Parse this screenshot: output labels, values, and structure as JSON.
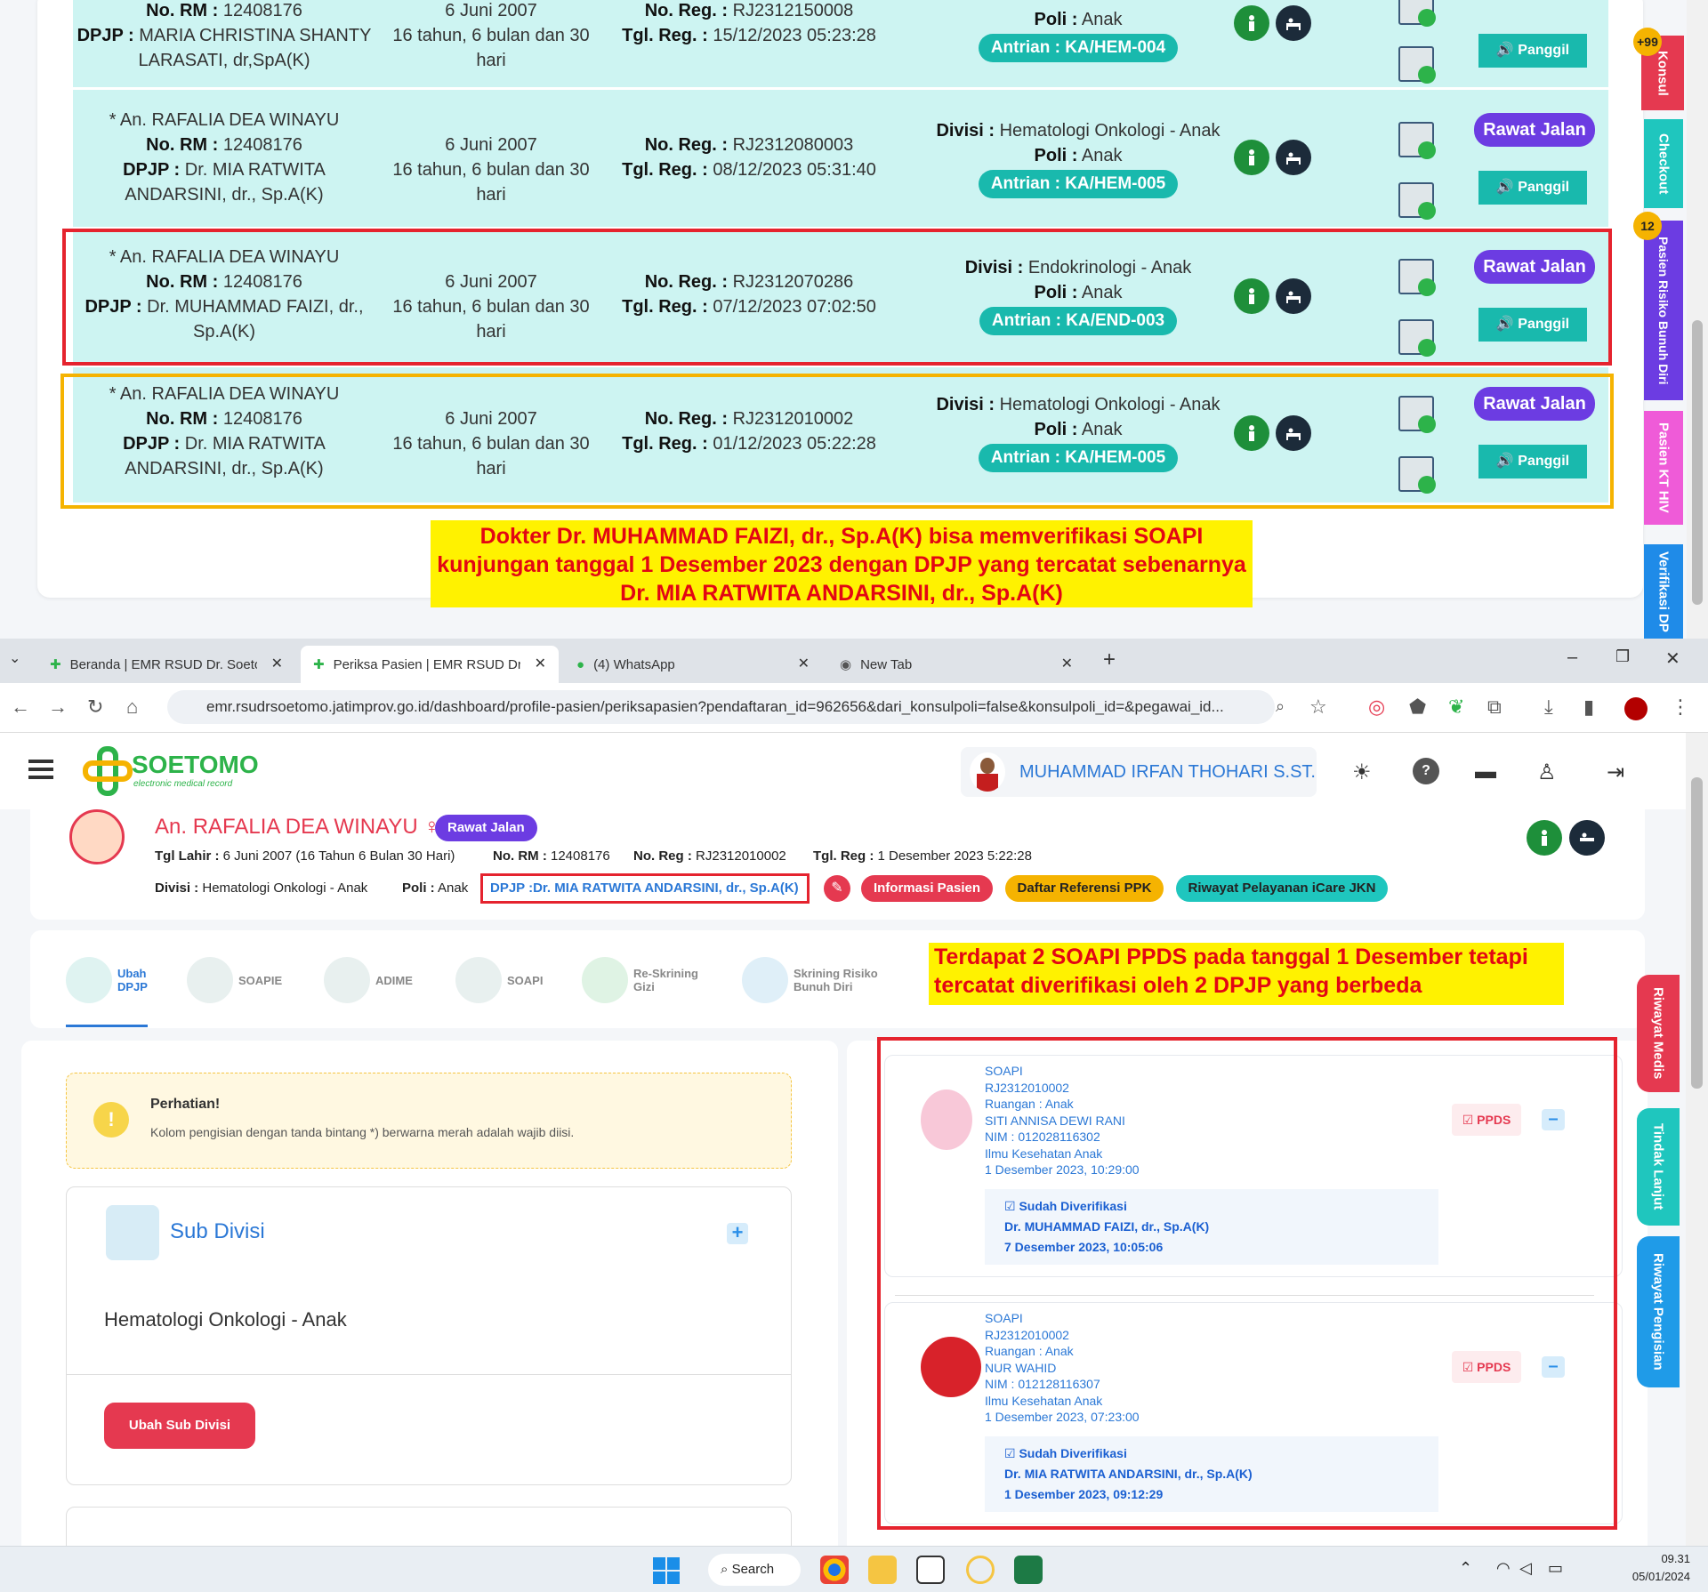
{
  "top_section": {
    "rows": [
      {
        "patient": "",
        "rm_label": "No. RM :",
        "rm": "12408176",
        "dpjp_label": "DPJP :",
        "dpjp": "MARIA CHRISTINA SHANTY LARASATI, dr,SpA(K)",
        "dob": "6 Juni 2007",
        "age": "16 tahun, 6 bulan dan 30 hari",
        "reg_label": "No. Reg. :",
        "reg": "RJ2312150008",
        "tgl_label": "Tgl. Reg. :",
        "tgl": "15/12/2023 05:23:28",
        "divisi_label": "",
        "divisi": "",
        "poli_label": "Poli :",
        "poli": "Anak",
        "antrian": "Antrian : KA/HEM-004",
        "status_btn": "",
        "call_btn": "Panggil"
      },
      {
        "patient": "* An. RAFALIA DEA WINAYU",
        "rm_label": "No. RM :",
        "rm": "12408176",
        "dpjp_label": "DPJP :",
        "dpjp": "Dr. MIA RATWITA ANDARSINI, dr., Sp.A(K)",
        "dob": "6 Juni 2007",
        "age": "16 tahun, 6 bulan dan 30 hari",
        "reg_label": "No. Reg. :",
        "reg": "RJ2312080003",
        "tgl_label": "Tgl. Reg. :",
        "tgl": "08/12/2023 05:31:40",
        "divisi_label": "Divisi :",
        "divisi": "Hematologi Onkologi - Anak",
        "poli_label": "Poli :",
        "poli": "Anak",
        "antrian": "Antrian : KA/HEM-005",
        "status_btn": "Rawat Jalan",
        "call_btn": "Panggil"
      },
      {
        "patient": "* An. RAFALIA DEA WINAYU",
        "rm_label": "No. RM :",
        "rm": "12408176",
        "dpjp_label": "DPJP :",
        "dpjp": "Dr. MUHAMMAD FAIZI, dr., Sp.A(K)",
        "dob": "6 Juni 2007",
        "age": "16 tahun, 6 bulan dan 30 hari",
        "reg_label": "No. Reg. :",
        "reg": "RJ2312070286",
        "tgl_label": "Tgl. Reg. :",
        "tgl": "07/12/2023 07:02:50",
        "divisi_label": "Divisi :",
        "divisi": "Endokrinologi - Anak",
        "poli_label": "Poli :",
        "poli": "Anak",
        "antrian": "Antrian : KA/END-003",
        "status_btn": "Rawat Jalan",
        "call_btn": "Panggil"
      },
      {
        "patient": "* An. RAFALIA DEA WINAYU",
        "rm_label": "No. RM :",
        "rm": "12408176",
        "dpjp_label": "DPJP :",
        "dpjp": "Dr. MIA RATWITA ANDARSINI, dr., Sp.A(K)",
        "dob": "6 Juni 2007",
        "age": "16 tahun, 6 bulan dan 30 hari",
        "reg_label": "No. Reg. :",
        "reg": "RJ2312010002",
        "tgl_label": "Tgl. Reg. :",
        "tgl": "01/12/2023 05:22:28",
        "divisi_label": "Divisi :",
        "divisi": "Hematologi Onkologi - Anak",
        "poli_label": "Poli :",
        "poli": "Anak",
        "antrian": "Antrian : KA/HEM-005",
        "status_btn": "Rawat Jalan",
        "call_btn": "Panggil"
      }
    ],
    "annotation_top": "Dokter Dr. MUHAMMAD FAIZI, dr., Sp.A(K) bisa memverifikasi SOAPI kunjungan tanggal 1 Desember 2023 dengan DPJP yang tercatat sebenarnya Dr. MIA RATWITA ANDARSINI, dr., Sp.A(K)",
    "side_tabs": [
      "Konsul",
      "Checkout",
      "Pasien Risiko Bunuh Diri",
      "Pasien KT HIV",
      "Verifikasi DP"
    ],
    "badges": [
      "+99",
      "12"
    ]
  },
  "browser": {
    "tabs": [
      {
        "label": "Beranda | EMR RSUD Dr. Soetomo"
      },
      {
        "label": "Periksa Pasien | EMR RSUD Dr. Soetomo"
      },
      {
        "label": "(4) WhatsApp"
      },
      {
        "label": "New Tab"
      }
    ],
    "url": "emr.rsudrsoetomo.jatimprov.go.id/dashboard/profile-pasien/periksapasien?pendaftaran_id=962656&dari_konsulpoli=false&konsulpoli_id=&pegawai_id..."
  },
  "app": {
    "logo_text": "SOETOMO",
    "logo_sub": "electronic medical record",
    "user_name": "MUHAMMAD IRFAN THOHARI S.ST.",
    "patient": {
      "name": "An. RAFALIA DEA WINAYU ♀",
      "status": "Rawat Jalan",
      "tgl_lahir_label": "Tgl Lahir :",
      "tgl_lahir": "6 Juni 2007 (16 Tahun 6 Bulan 30 Hari)",
      "rm_label": "No. RM :",
      "rm": "12408176",
      "reg_label": "No. Reg :",
      "reg": "RJ2312010002",
      "tgl_reg_label": "Tgl. Reg :",
      "tgl_reg": "1 Desember 2023 5:22:28",
      "divisi_label": "Divisi :",
      "divisi": "Hematologi Onkologi - Anak",
      "poli_label": "Poli :",
      "poli": "Anak",
      "dpjp": "DPJP :Dr. MIA RATWITA ANDARSINI, dr., Sp.A(K)",
      "btn_info": "Informasi Pasien",
      "btn_ref": "Daftar Referensi PPK",
      "btn_icare": "Riwayat Pelayanan iCare JKN"
    },
    "menu": [
      {
        "label": "Ubah DPJP"
      },
      {
        "label": "SOAPIE"
      },
      {
        "label": "ADIME"
      },
      {
        "label": "SOAPI"
      },
      {
        "label": "Re-Skrining Gizi"
      },
      {
        "label": "Skrining Risiko Bunuh Diri"
      }
    ],
    "annotation_mid": "Terdapat 2 SOAPI PPDS pada tanggal 1 Desember tetapi tercatat diverifikasi oleh 2 DPJP yang berbeda",
    "warning_title": "Perhatian!",
    "warning_text": "Kolom pengisian dengan tanda bintang *) berwarna merah adalah wajib diisi.",
    "subdiv_title": "Sub Divisi",
    "subdiv_value": "Hematologi Onkologi - Anak",
    "subdiv_btn": "Ubah Sub Divisi",
    "soapi": [
      {
        "type": "SOAPI",
        "reg": "RJ2312010002",
        "ruangan": "Ruangan : Anak",
        "name": "SITI ANNISA DEWI RANI",
        "nim": "NIM : 012028116302",
        "prodi": "Ilmu Kesehatan Anak",
        "datetime": "1 Desember 2023, 10:29:00",
        "ver_status": "Sudah Diverifikasi",
        "ver_by": "Dr. MUHAMMAD FAIZI, dr., Sp.A(K)",
        "ver_date": "7 Desember 2023, 10:05:06",
        "badge": "PPDS"
      },
      {
        "type": "SOAPI",
        "reg": "RJ2312010002",
        "ruangan": "Ruangan : Anak",
        "name": "NUR WAHID",
        "nim": "NIM : 012128116307",
        "prodi": "Ilmu Kesehatan Anak",
        "datetime": "1 Desember 2023, 07:23:00",
        "ver_status": "Sudah Diverifikasi",
        "ver_by": "Dr. MIA RATWITA ANDARSINI, dr., Sp.A(K)",
        "ver_date": "1 Desember 2023, 09:12:29",
        "badge": "PPDS"
      }
    ],
    "right_tabs": [
      "Riwayat Medis",
      "Tindak Lanjut",
      "Riwayat Pengisian"
    ]
  },
  "taskbar": {
    "search": "Search",
    "time": "09.31",
    "date": "05/01/2024"
  }
}
